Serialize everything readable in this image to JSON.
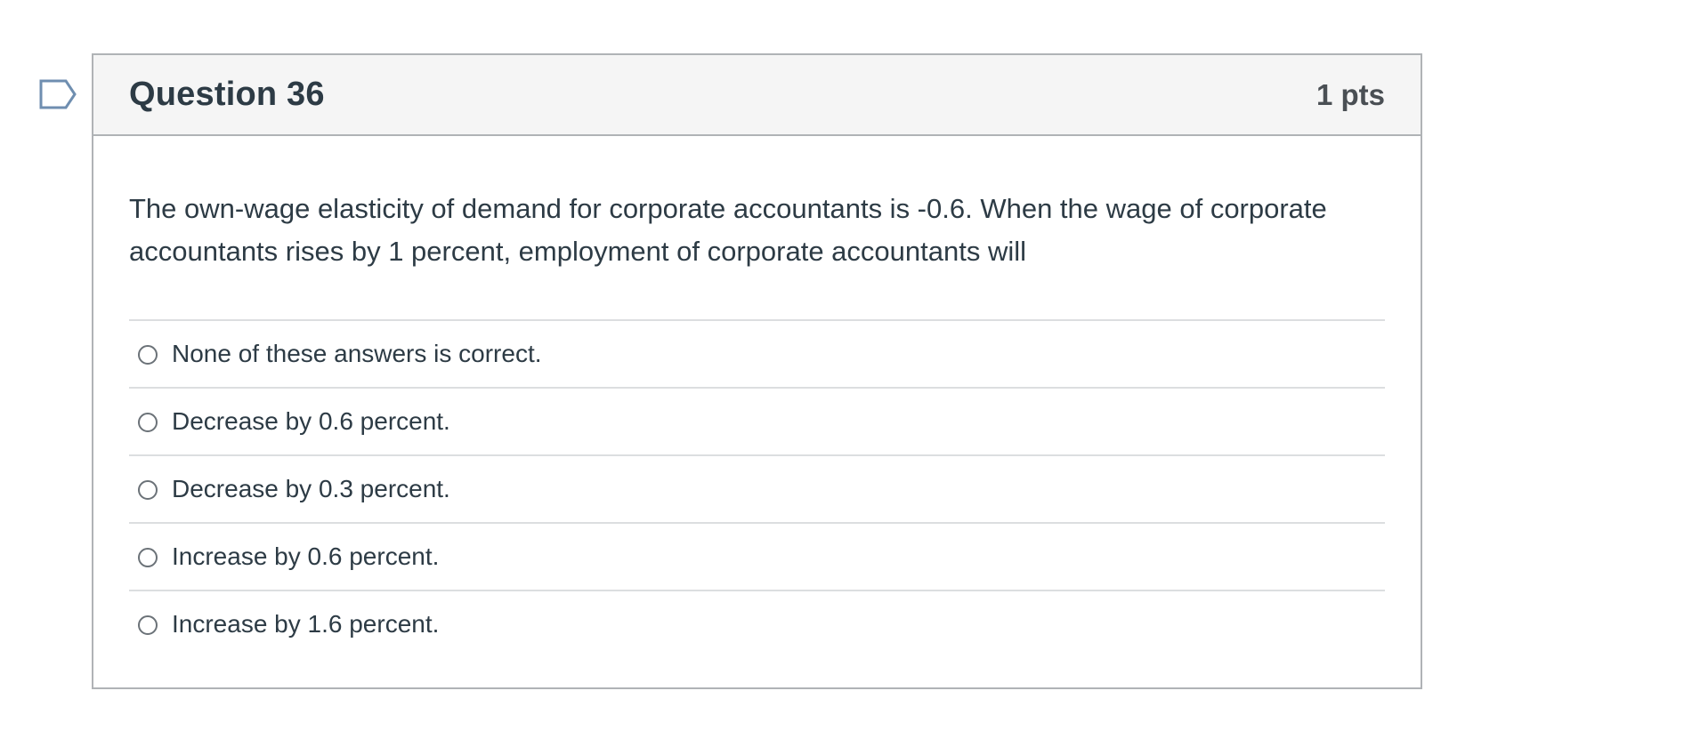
{
  "question": {
    "title": "Question 36",
    "points": "1 pts",
    "flag_icon": "flag-outline-icon",
    "text": "The own-wage elasticity of demand for corporate accountants is -0.6. When the wage of corporate accountants rises by 1 percent, employment of corporate accountants will",
    "answers": [
      {
        "label": "None of these answers is correct.",
        "selected": false
      },
      {
        "label": "Decrease by 0.6 percent.",
        "selected": false
      },
      {
        "label": "Decrease by 0.3 percent.",
        "selected": false
      },
      {
        "label": "Increase by 0.6 percent.",
        "selected": false
      },
      {
        "label": "Increase by 1.6 percent.",
        "selected": false
      }
    ]
  },
  "colors": {
    "text": "#2d3b45",
    "header_bg": "#f5f5f5",
    "border": "#b0b3b6",
    "divider": "#dcdee0",
    "flag": "#6f8eb0"
  }
}
